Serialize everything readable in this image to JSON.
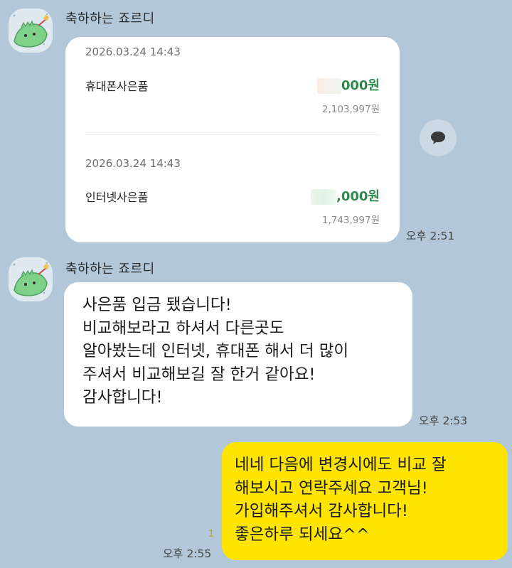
{
  "chat": {
    "sender_name": "축하하는 죠르디",
    "card": {
      "transactions": [
        {
          "date": "2026.03.24 14:43",
          "title": "휴대폰사은품",
          "amount_visible": "000원",
          "balance": "2,103,997원"
        },
        {
          "date": "2026.03.24 14:43",
          "title": "인터넷사은품",
          "amount_visible": ",000원",
          "balance": "1,743,997원"
        }
      ],
      "time": "오후 2:51"
    },
    "share_icon": "speech-bubble-icon",
    "incoming_message": {
      "text": "사은품 입금 됐습니다!\n비교해보라고 하셔서 다른곳도\n알아봤는데 인터넷, 휴대폰 해서 더 많이\n주셔서 비교해보길 잘 한거 같아요!\n감사합니다!",
      "time": "오후 2:53"
    },
    "outgoing_message": {
      "text": "네네 다음에 변경시에도 비교 잘\n해보시고 연락주세요 고객님!\n가입해주셔서 감사합니다!\n좋은하루 되세요^^",
      "time": "오후 2:55",
      "unread_count": "1"
    }
  },
  "colors": {
    "background": "#b2c7d9",
    "outgoing_bubble": "#fee500",
    "amount_green": "#2f8a4f"
  }
}
